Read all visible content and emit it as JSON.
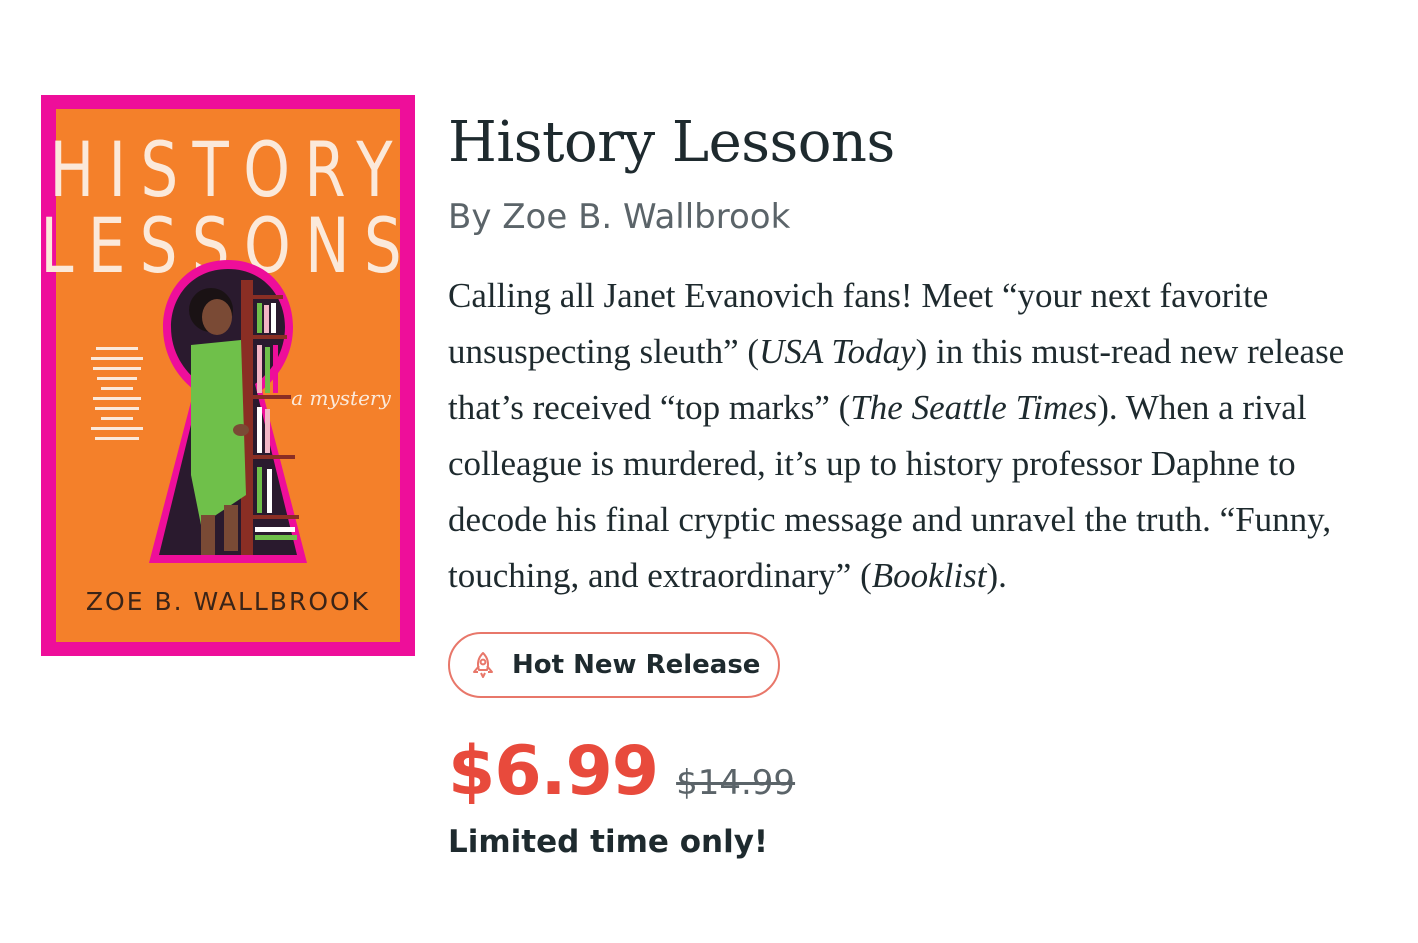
{
  "book": {
    "title": "History Lessons",
    "author_line": "By Zoe B. Wallbrook",
    "description": [
      {
        "text": "Calling all Janet Evanovich fans! Meet “your next favorite unsuspecting sleuth” (",
        "italic": false
      },
      {
        "text": "USA Today",
        "italic": true
      },
      {
        "text": ") in this must-read new release that’s received “top marks” (",
        "italic": false
      },
      {
        "text": "The Seattle Times",
        "italic": true
      },
      {
        "text": "). When a rival colleague is murdered, it’s up to history professor Daphne to decode his final cryptic message and unravel the truth. “Funny, touching, and extraordinary” (",
        "italic": false
      },
      {
        "text": "Booklist",
        "italic": true
      },
      {
        "text": ").",
        "italic": false
      }
    ]
  },
  "cover": {
    "title_line1": "HISTORY",
    "title_line2": "LESSONS",
    "subtitle": "a mystery",
    "author": "ZOE B. WALLBROOK",
    "border_color": "#ee0e9a",
    "background_color": "#f4802a"
  },
  "badge": {
    "label": "Hot New Release",
    "icon": "rocket-icon",
    "border_color": "#e8776a"
  },
  "pricing": {
    "sale_price": "$6.99",
    "list_price": "$14.99",
    "note": "Limited time only!",
    "sale_color": "#e84a3c"
  }
}
